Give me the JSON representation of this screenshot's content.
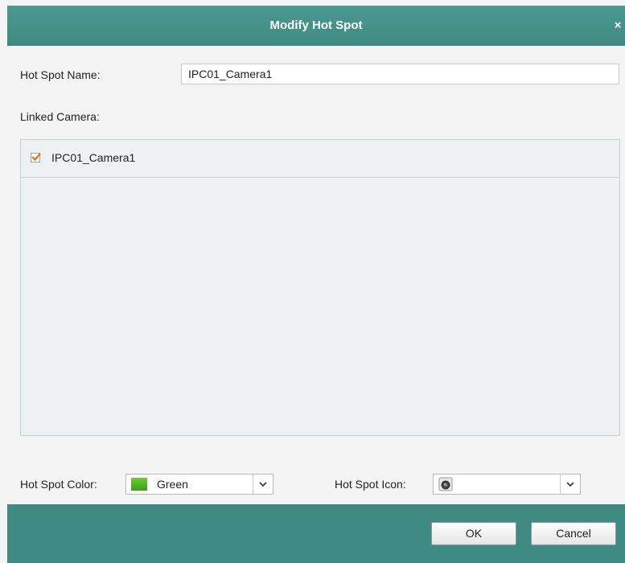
{
  "dialog": {
    "title": "Modify Hot Spot",
    "close_glyph": "×"
  },
  "form": {
    "name_label": "Hot Spot Name:",
    "name_value": "IPC01_Camera1",
    "linked_label": "Linked Camera:",
    "cameras": [
      {
        "name": "IPC01_Camera1",
        "checked": true
      }
    ],
    "color_label": "Hot Spot Color:",
    "color_value": "Green",
    "color_hex": "#4cb52a",
    "icon_label": "Hot Spot Icon:",
    "icon_value": "camera-icon"
  },
  "buttons": {
    "ok": "OK",
    "cancel": "Cancel"
  },
  "colors": {
    "accent": "#3f8a83",
    "checkbox_check": "#e86a1f"
  }
}
